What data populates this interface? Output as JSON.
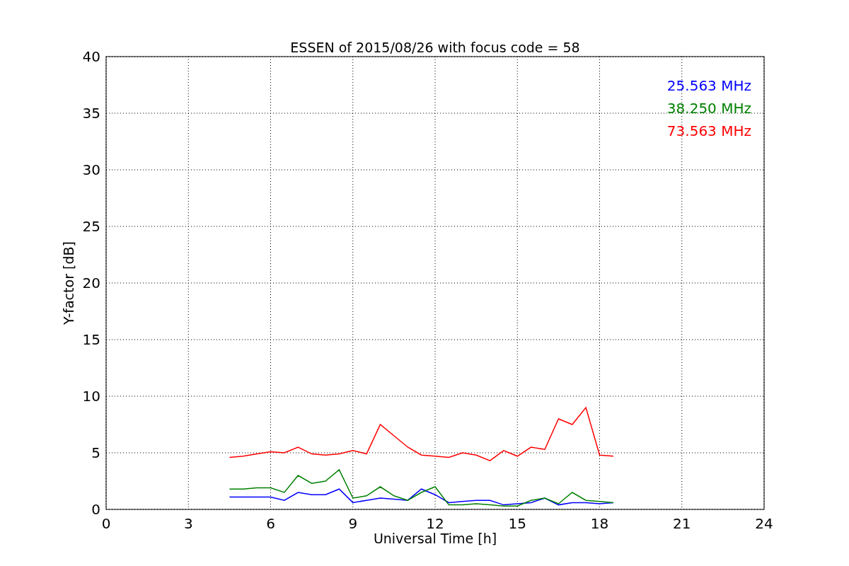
{
  "chart_data": {
    "type": "line",
    "title": "ESSEN of 2015/08/26 with focus code = 58",
    "xlabel": "Universal Time [h]",
    "ylabel": "Y-factor [dB]",
    "x": [
      4.5,
      5,
      5.5,
      6,
      6.5,
      7,
      7.5,
      8,
      8.5,
      9,
      9.5,
      10,
      10.5,
      11,
      11.5,
      12,
      12.5,
      13,
      13.5,
      14,
      14.5,
      15,
      15.5,
      16,
      16.5,
      17,
      17.5,
      18,
      18.5
    ],
    "series": [
      {
        "name": "25.563 MHz",
        "color": "#0000ff",
        "values": [
          1.1,
          1.1,
          1.1,
          1.1,
          0.8,
          1.5,
          1.3,
          1.3,
          1.8,
          0.6,
          0.8,
          1.0,
          0.9,
          0.8,
          1.8,
          1.3,
          0.6,
          0.7,
          0.8,
          0.8,
          0.4,
          0.5,
          0.6,
          1.0,
          0.4,
          0.6,
          0.6,
          0.5,
          0.6
        ]
      },
      {
        "name": "38.250 MHz",
        "color": "#008000",
        "values": [
          1.8,
          1.8,
          1.9,
          1.9,
          1.5,
          3.0,
          2.3,
          2.5,
          3.5,
          1.0,
          1.2,
          2.0,
          1.2,
          0.8,
          1.5,
          2.0,
          0.4,
          0.4,
          0.5,
          0.4,
          0.3,
          0.3,
          0.8,
          1.0,
          0.5,
          1.5,
          0.8,
          0.7,
          0.6
        ]
      },
      {
        "name": "73.563 MHz",
        "color": "#ff0000",
        "values": [
          4.6,
          4.7,
          4.9,
          5.1,
          5.0,
          5.5,
          4.9,
          4.8,
          4.9,
          5.2,
          4.9,
          7.5,
          6.5,
          5.5,
          4.8,
          4.7,
          4.6,
          5.0,
          4.8,
          4.3,
          5.2,
          4.7,
          5.5,
          5.3,
          8.0,
          7.5,
          9.0,
          4.8,
          4.7
        ]
      }
    ],
    "grid": true,
    "xlim": [
      0,
      24
    ],
    "ylim": [
      0,
      40
    ],
    "xticks": [
      0,
      3,
      6,
      9,
      12,
      15,
      18,
      21,
      24
    ],
    "yticks": [
      0,
      5,
      10,
      15,
      20,
      25,
      30,
      35,
      40
    ]
  }
}
